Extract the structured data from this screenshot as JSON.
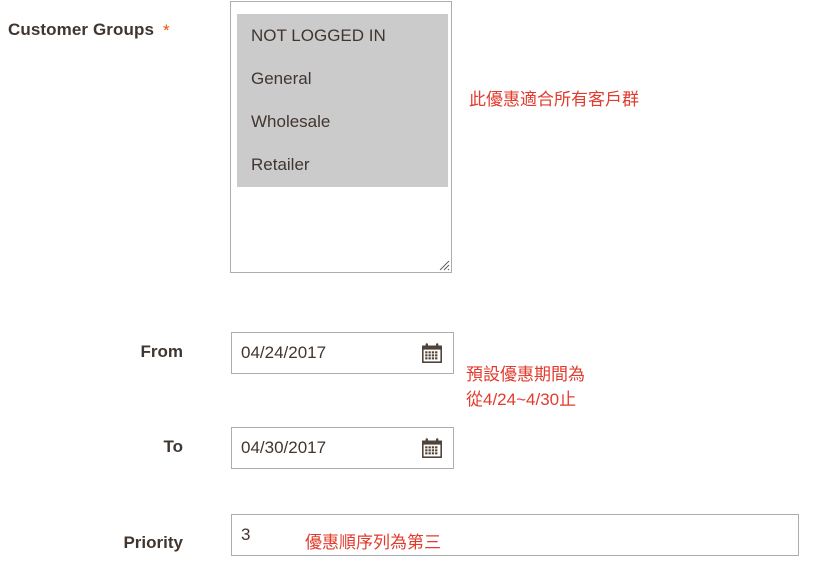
{
  "form": {
    "customer_groups": {
      "label": "Customer Groups",
      "required_marker": "*",
      "options": [
        {
          "label": "NOT LOGGED IN",
          "selected": true
        },
        {
          "label": "General",
          "selected": true
        },
        {
          "label": "Wholesale",
          "selected": true
        },
        {
          "label": "Retailer",
          "selected": true
        }
      ],
      "annotation": "此優惠適合所有客戶群"
    },
    "from": {
      "label": "From",
      "value": "04/24/2017",
      "calendar_icon": "calendar-icon"
    },
    "to": {
      "label": "To",
      "value": "04/30/2017",
      "calendar_icon": "calendar-icon"
    },
    "date_annotation": {
      "line1": "預設優惠期間為",
      "line2": "從4/24~4/30止"
    },
    "priority": {
      "label": "Priority",
      "value": "3",
      "annotation": "優惠順序列為第三"
    }
  },
  "colors": {
    "label_text": "#41362f",
    "required_star": "#eb5202",
    "annotation_red": "#e23b2e",
    "selected_option_bg": "#cbcbcb",
    "input_border": "#adadad",
    "page_bg": "#ffffff",
    "calendar_icon_body": "#514337",
    "calendar_icon_accent": "#e36b1f"
  }
}
